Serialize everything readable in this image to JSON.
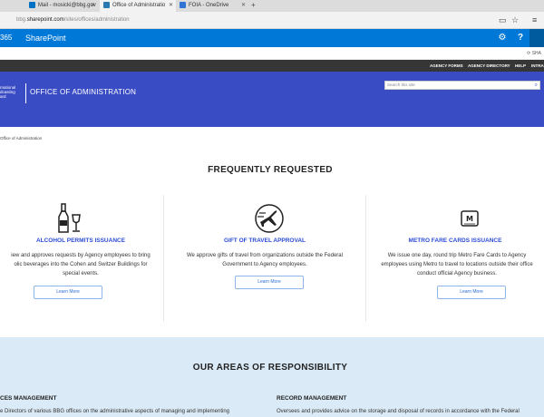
{
  "browser": {
    "tabs": [
      {
        "label": "Mail - mosicki@bbg.gov",
        "active": false,
        "icon": "outlook-icon",
        "color": "#0072c6"
      },
      {
        "label": "Office of Administratio",
        "active": true,
        "icon": "sharepoint-icon",
        "color": "#2a7ab0"
      },
      {
        "label": "FOIA - OneDrive",
        "active": false,
        "icon": "onedrive-icon",
        "color": "#2f73d6"
      }
    ],
    "new_tab": "+",
    "url_prefix": "bbg.",
    "url_host": "sharepoint.com",
    "url_path": "/sites/offices/administration"
  },
  "suite": {
    "o365_label": "365",
    "app_label": "SharePoint",
    "accent": "#0078d7"
  },
  "sharebar": {
    "share_label": "SHA"
  },
  "site": {
    "top_links": [
      "AGENCY FORMS",
      "AGENCY DIRECTORY",
      "HELP",
      "INTRA"
    ],
    "logo_lines": [
      "rnational",
      "dcasting",
      "ard"
    ],
    "title": "OFFICE OF ADMINISTRATION",
    "search_placeholder": "Search this site",
    "nav": [
      "What We Do ▾",
      "Online Forms",
      "BAM",
      "Contact Us"
    ],
    "banner_color": "#3a4cc4"
  },
  "breadcrumb": "Office of Administration",
  "frequently_requested": {
    "title": "FREQUENTLY REQUESTED",
    "cards": [
      {
        "icon": "wine-bottle-icon",
        "title": "ALCOHOL PERMITS ISSUANCE",
        "desc": [
          "iew and approves requests by Agency employees to bring",
          "olic beverages into the Cohen and Switzer Buildings for",
          "special events."
        ],
        "button": "Learn More"
      },
      {
        "icon": "plane-gift-icon",
        "title": "GIFT OF TRAVEL APPROVAL",
        "desc": [
          "We approve gifts of travel from organizations outside the Federal",
          "Government to Agency employees."
        ],
        "button": "Learn More"
      },
      {
        "icon": "metro-card-icon",
        "title": "METRO FARE CARDS ISSUANCE",
        "desc": [
          "We issue one day, round trip Metro Fare Cards to Agency",
          "employees using Metro to travel to locations outside their office",
          "conduct official Agency business."
        ],
        "button": "Learn More"
      }
    ]
  },
  "responsibility": {
    "title": "OUR AREAS OF RESPONSIBILITY",
    "areas": [
      {
        "heading": "CES MANAGEMENT",
        "text": "e Directors of various BBG offices on the administrative aspects of managing and implementing"
      },
      {
        "heading": "RECORD MANAGEMENT",
        "text": "Oversees and provides advice on the storage and disposal of records in accordance with the Federal"
      }
    ]
  }
}
